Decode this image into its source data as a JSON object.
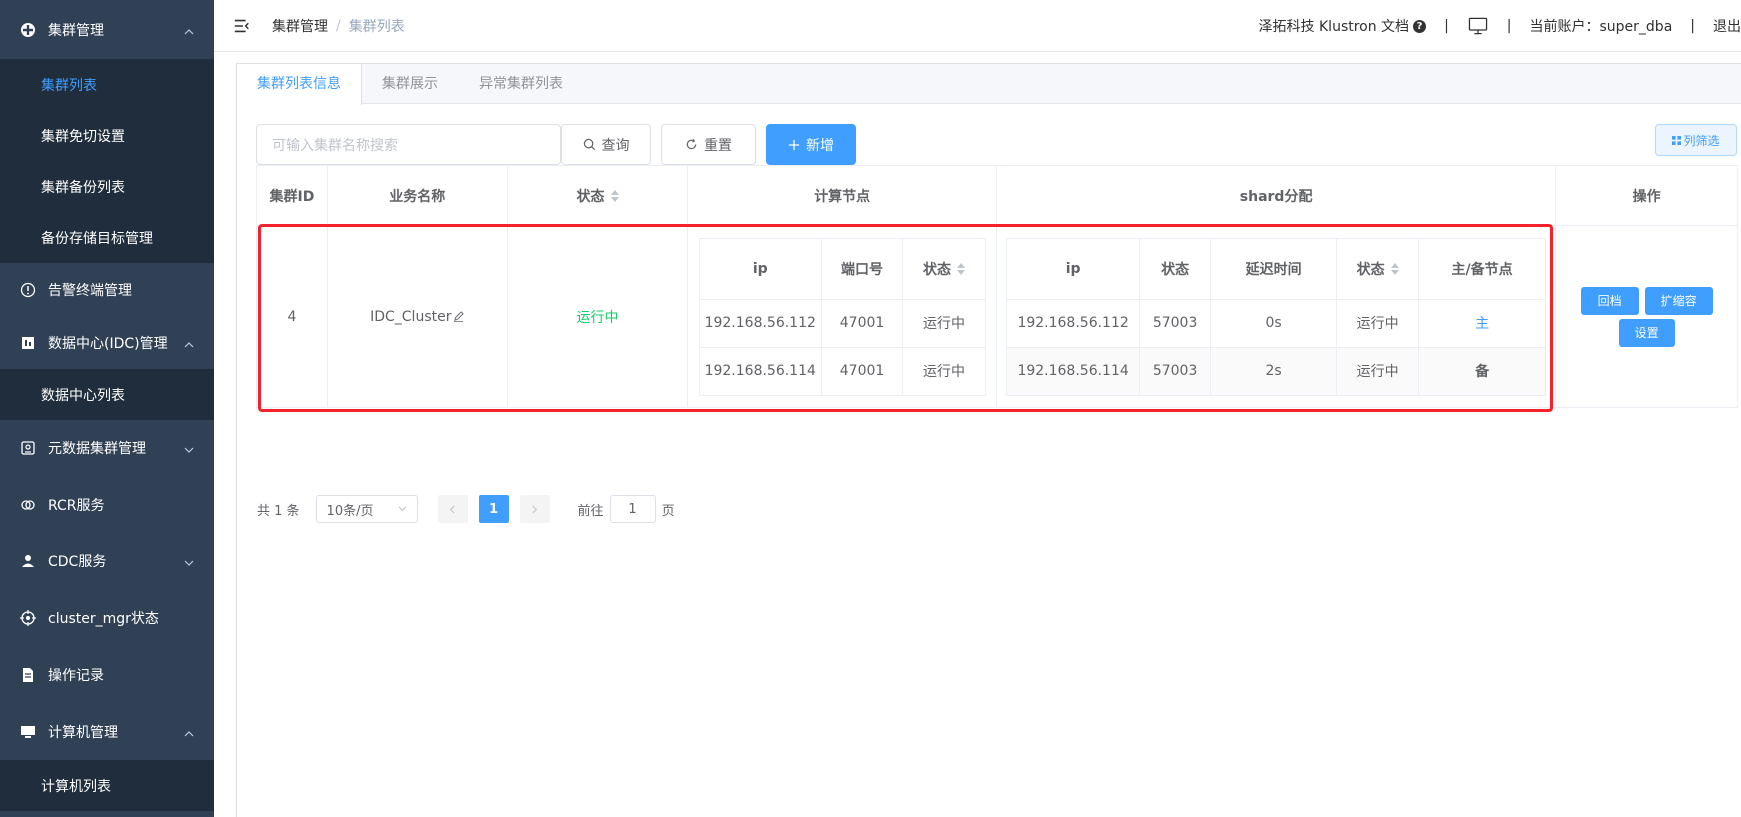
{
  "sidebar": {
    "groups": [
      {
        "label": "集群管理",
        "icon": "cluster-icon"
      },
      {
        "label": "告警终端管理",
        "icon": "alert-icon"
      },
      {
        "label": "数据中心(IDC)管理",
        "icon": "datacenter-icon"
      },
      {
        "label": "元数据集群管理",
        "icon": "metadata-icon"
      },
      {
        "label": "RCR服务",
        "icon": "rcr-icon"
      },
      {
        "label": "CDC服务",
        "icon": "cdc-icon"
      },
      {
        "label": "cluster_mgr状态",
        "icon": "target-icon"
      },
      {
        "label": "操作记录",
        "icon": "record-icon"
      },
      {
        "label": "计算机管理",
        "icon": "computer-icon"
      }
    ],
    "cluster_items": [
      "集群列表",
      "集群免切设置",
      "集群备份列表",
      "备份存储目标管理"
    ],
    "idc_items": [
      "数据中心列表"
    ],
    "computer_items": [
      "计算机列表"
    ]
  },
  "header": {
    "breadcrumb_1": "集群管理",
    "breadcrumb_sep": "/",
    "breadcrumb_2": "集群列表",
    "doc_link": "泽拓科技 Klustron 文档",
    "separator": "|",
    "account": "当前账户：super_dba",
    "logout": "退出"
  },
  "tabs": [
    "集群列表信息",
    "集群展示",
    "异常集群列表"
  ],
  "toolbar": {
    "search_placeholder": "可输入集群名称搜索",
    "query_label": "查询",
    "reset_label": "重置",
    "add_label": "新增",
    "filter_label": "列筛选"
  },
  "table": {
    "headers": {
      "id": "集群ID",
      "name": "业务名称",
      "status": "状态",
      "compute": "计算节点",
      "shard": "shard分配",
      "op": "操作"
    },
    "compute_headers": [
      "ip",
      "端口号",
      "状态"
    ],
    "shard_headers": [
      "ip",
      "状态",
      "延迟时间",
      "状态",
      "主/备节点"
    ],
    "row": {
      "id": "4",
      "name": "IDC_Cluster",
      "status": "运行中",
      "compute_nodes": [
        {
          "ip": "192.168.56.112",
          "port": "47001",
          "status": "运行中"
        },
        {
          "ip": "192.168.56.114",
          "port": "47001",
          "status": "运行中"
        }
      ],
      "shards": [
        {
          "ip": "192.168.56.112",
          "port": "57003",
          "delay": "0s",
          "status": "运行中",
          "role": "主"
        },
        {
          "ip": "192.168.56.114",
          "port": "57003",
          "delay": "2s",
          "status": "运行中",
          "role": "备"
        }
      ],
      "actions": [
        "回档",
        "扩缩容",
        "设置"
      ]
    }
  },
  "pagination": {
    "total": "共 1 条",
    "page_size": "10条/页",
    "current": "1",
    "goto_prefix": "前往",
    "goto_value": "1",
    "goto_suffix": "页"
  },
  "colors": {
    "sidebar_bg": "#304156",
    "submenu_bg": "#1f2d3d",
    "accent": "#409eff",
    "running": "#13ce66",
    "highlight": "#f5222d"
  }
}
